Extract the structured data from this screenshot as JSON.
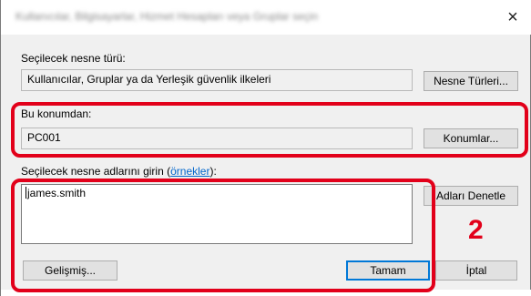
{
  "window": {
    "title": "Kullanıcılar, Bilgisayarlar, Hizmet Hesapları veya Gruplar seçin",
    "close_label": "×"
  },
  "object_type": {
    "label": "Seçilecek nesne türü:",
    "value": "Kullanıcılar, Gruplar ya da Yerleşik güvenlik ilkeleri",
    "button": "Nesne Türleri..."
  },
  "location": {
    "label": "Bu konumdan:",
    "value": "PC001",
    "button": "Konumlar..."
  },
  "names": {
    "label_prefix": "Seçilecek nesne adlarını girin (",
    "link": "örnekler",
    "label_suffix": "):",
    "value": "james.smith",
    "check_button": "Adları Denetle"
  },
  "footer": {
    "advanced_button": "Gelişmiş...",
    "ok_button": "Tamam",
    "cancel_button": "İptal"
  },
  "callout": {
    "number": "2",
    "color": "#e2001a"
  }
}
